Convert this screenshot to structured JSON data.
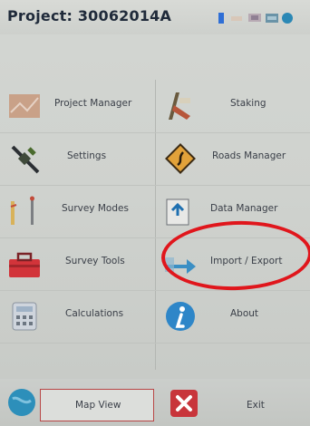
{
  "header": {
    "title": "Project: 30062014A",
    "status_icons": [
      "signal-icon",
      "battery-icon",
      "network-icon",
      "keyboard-icon",
      "globe-icon"
    ]
  },
  "menu": {
    "left": [
      {
        "label": "Project Manager",
        "icon": "project-manager-icon"
      },
      {
        "label": "Settings",
        "icon": "satellite-icon"
      },
      {
        "label": "Survey Modes",
        "icon": "survey-rod-icon"
      },
      {
        "label": "Survey Tools",
        "icon": "toolbox-icon"
      },
      {
        "label": "Calculations",
        "icon": "calculator-icon"
      }
    ],
    "right": [
      {
        "label": "Staking",
        "icon": "staking-icon"
      },
      {
        "label": "Roads Manager",
        "icon": "road-sign-icon"
      },
      {
        "label": "Data Manager",
        "icon": "data-manager-icon"
      },
      {
        "label": "Import / Export",
        "icon": "import-export-icon"
      },
      {
        "label": "About",
        "icon": "info-icon"
      }
    ]
  },
  "footer": {
    "map_view_label": "Map View",
    "exit_label": "Exit"
  },
  "annotation": {
    "highlight_color": "#e0161c",
    "highlighted_item": "Import / Export"
  }
}
